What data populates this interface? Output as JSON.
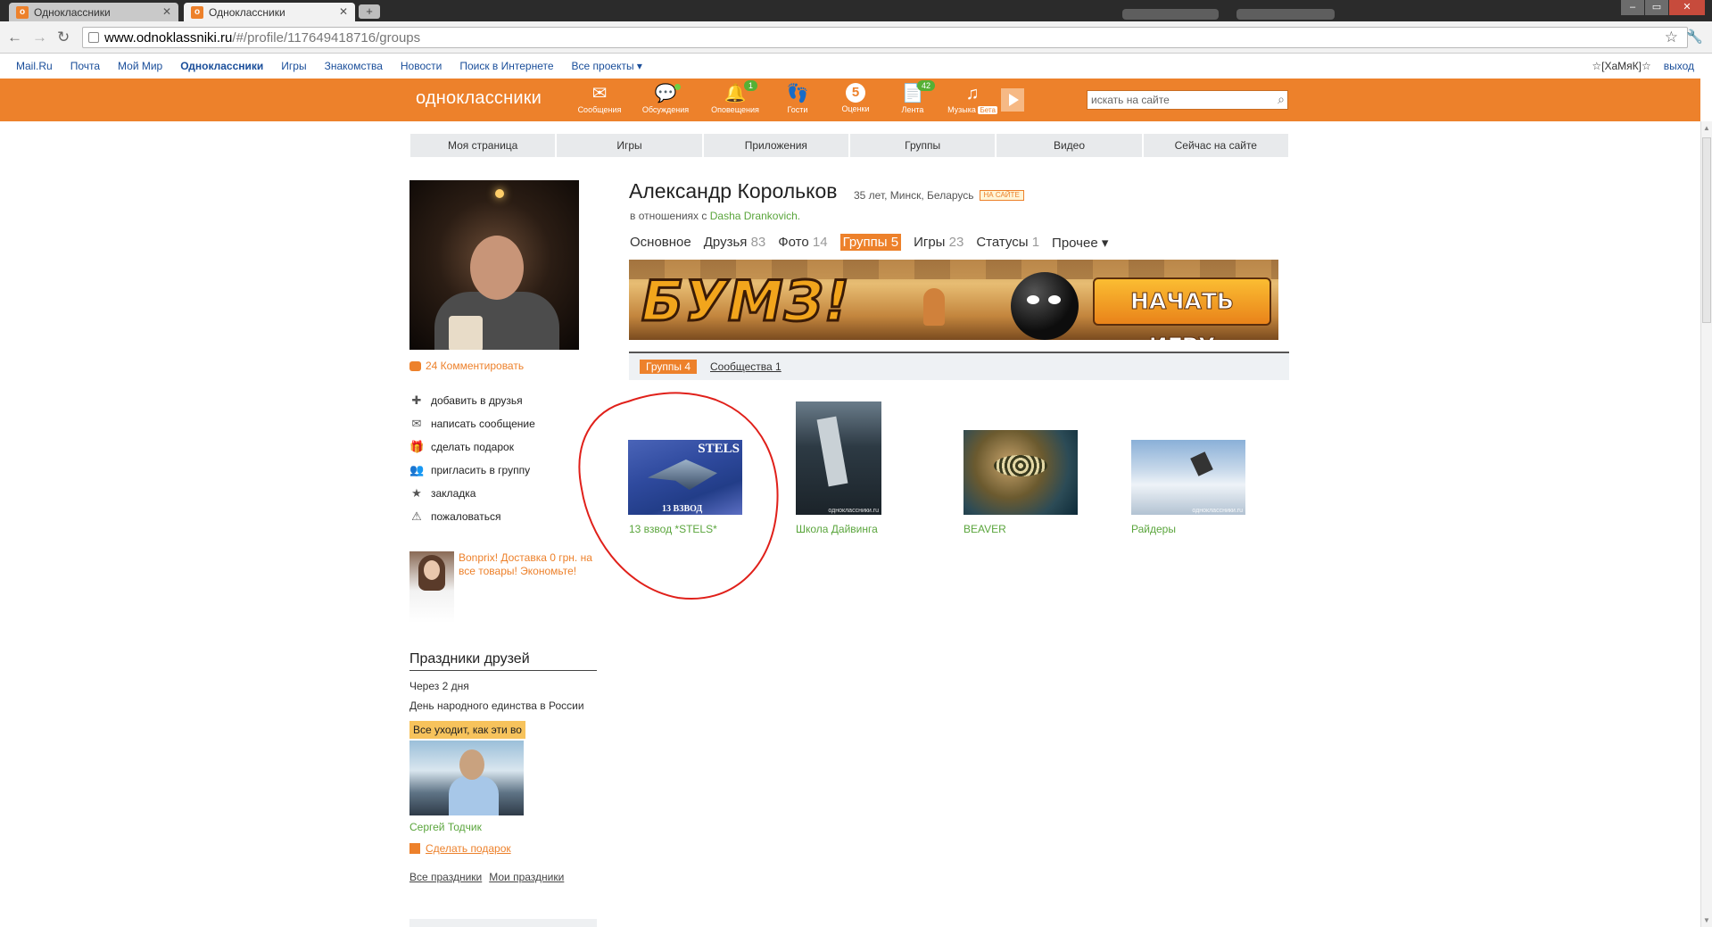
{
  "browser": {
    "tabs": [
      {
        "title": "Одноклассники",
        "active": false
      },
      {
        "title": "Одноклассники",
        "active": true
      }
    ],
    "url_host": "www.odnoklassniki.ru",
    "url_path": "/#/profile/117649418716/groups"
  },
  "mailbar": {
    "links": [
      "Mail.Ru",
      "Почта",
      "Мой Мир",
      "Одноклассники",
      "Игры",
      "Знакомства",
      "Новости",
      "Поиск в Интернете",
      "Все проекты ▾"
    ],
    "nick": "☆[ХаМяК]☆",
    "logout": "выход"
  },
  "header": {
    "logo": "одноклассники",
    "nav": [
      {
        "label": "Сообщения",
        "icon": "envelope-icon"
      },
      {
        "label": "Обсуждения",
        "icon": "chat-icon"
      },
      {
        "label": "Оповещения",
        "icon": "bell-icon",
        "badge": "1"
      },
      {
        "label": "Гости",
        "icon": "footprints-icon"
      },
      {
        "label": "Оценки",
        "icon": "rating-icon",
        "value": "5"
      },
      {
        "label": "Лента",
        "icon": "feed-icon",
        "badge": "42"
      },
      {
        "label": "Музыка",
        "icon": "music-icon",
        "extra": "Бета"
      }
    ],
    "search_placeholder": "искать на сайте",
    "accent": "#ed812b"
  },
  "subnav": [
    "Моя страница",
    "Игры",
    "Приложения",
    "Группы",
    "Видео",
    "Сейчас на сайте"
  ],
  "left": {
    "comments": "24 Комментировать",
    "actions": [
      "добавить в друзья",
      "написать сообщение",
      "сделать подарок",
      "пригласить в группу",
      "закладка",
      "пожаловаться"
    ],
    "ad_text": "Bonprix! Доставка 0 грн. на все товары! Экономьте!",
    "holidays": {
      "title": "Праздники друзей",
      "when": "Через 2 дня",
      "event": "День народного единства в России",
      "note": "Все уходит, как эти во",
      "friend": "Сергей Тодчик",
      "gift": "Сделать подарок",
      "all": "Все праздники",
      "mine": "Мои праздники"
    }
  },
  "profile": {
    "name": "Александр Корольков",
    "meta": "35 лет, Минск, Беларусь",
    "status_badge": "НА САЙТЕ",
    "relation_prefix": "в отношениях с",
    "relation_name": "Dasha Drankovich.",
    "tabs": [
      {
        "label": "Основное",
        "count": ""
      },
      {
        "label": "Друзья",
        "count": "83"
      },
      {
        "label": "Фото",
        "count": "14"
      },
      {
        "label": "Группы",
        "count": "5"
      },
      {
        "label": "Игры",
        "count": "23"
      },
      {
        "label": "Статусы",
        "count": "1"
      },
      {
        "label": "Прочее ▾",
        "count": ""
      }
    ]
  },
  "banner": {
    "title": "БУМЗ!",
    "cta": "НАЧАТЬ ИГРУ"
  },
  "groups": {
    "tab_groups": "Группы 4",
    "tab_communities": "Сообщества 1",
    "items": [
      {
        "caption": "13 взвод *STELS*",
        "overlay_top": "STELS",
        "overlay_bottom": "13 ВЗВОД"
      },
      {
        "caption": "Школа Дайвинга",
        "watermark": "одноклассники.ru"
      },
      {
        "caption": "BEAVER"
      },
      {
        "caption": "Райдеры",
        "watermark": "одноклассники.ru"
      }
    ]
  },
  "annotation": {
    "color": "#e0201a"
  }
}
